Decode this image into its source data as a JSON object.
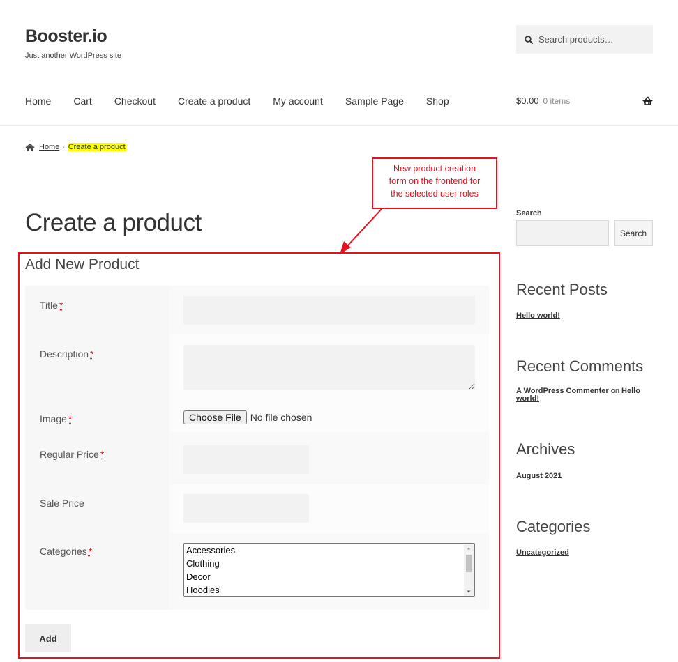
{
  "site": {
    "title": "Booster.io",
    "tagline": "Just another WordPress site"
  },
  "header_search": {
    "placeholder": "Search products…",
    "icon": "search-icon"
  },
  "nav": {
    "items": [
      {
        "label": "Home"
      },
      {
        "label": "Cart"
      },
      {
        "label": "Checkout"
      },
      {
        "label": "Create a product"
      },
      {
        "label": "My account"
      },
      {
        "label": "Sample Page"
      },
      {
        "label": "Shop"
      }
    ]
  },
  "cart": {
    "amount": "$0.00",
    "count": "0 items",
    "icon": "basket-icon"
  },
  "breadcrumb": {
    "home": "Home",
    "current": "Create a product",
    "icon": "home-icon"
  },
  "annotation": {
    "line1": "New product creation",
    "line2": "form on the frontend for",
    "line3": "the selected user roles",
    "color": "#e8101c"
  },
  "page": {
    "title": "Create a product"
  },
  "form": {
    "heading": "Add New Product",
    "required_mark": "*",
    "fields": {
      "title": {
        "label": "Title"
      },
      "description": {
        "label": "Description"
      },
      "image": {
        "label": "Image",
        "button": "Choose File",
        "status": "No file chosen"
      },
      "regular_price": {
        "label": "Regular Price"
      },
      "sale_price": {
        "label": "Sale Price"
      },
      "categories": {
        "label": "Categories",
        "options": [
          "Accessories",
          "Clothing",
          "Decor",
          "Hoodies"
        ]
      }
    },
    "submit": "Add"
  },
  "sidebar": {
    "search": {
      "label": "Search",
      "button": "Search"
    },
    "recent_posts": {
      "title": "Recent Posts",
      "items": [
        "Hello world!"
      ]
    },
    "recent_comments": {
      "title": "Recent Comments",
      "author": "A WordPress Commenter",
      "on": "on",
      "post": "Hello world!"
    },
    "archives": {
      "title": "Archives",
      "items": [
        "August 2021"
      ]
    },
    "categories": {
      "title": "Categories",
      "items": [
        "Uncategorized"
      ]
    }
  }
}
